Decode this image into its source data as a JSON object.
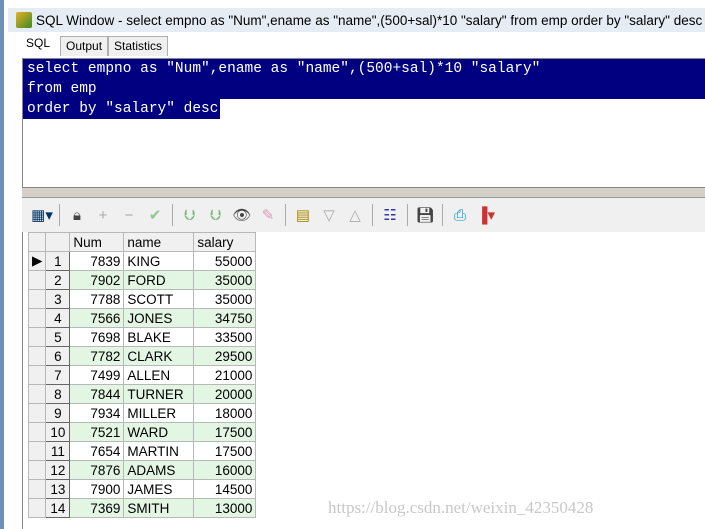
{
  "window": {
    "title": "SQL Window - select empno as \"Num\",ename as \"name\",(500+sal)*10 \"salary\" from emp order by \"salary\" desc"
  },
  "tabs": [
    {
      "label": "SQL",
      "active": true
    },
    {
      "label": "Output"
    },
    {
      "label": "Statistics"
    }
  ],
  "editor": {
    "lines": [
      "select empno as \"Num\",ename as \"name\",(500+sal)*10 \"salary\"",
      "from emp",
      "order by \"salary\" desc"
    ]
  },
  "toolbar": [
    "grid-view-icon",
    "lock-icon",
    "add-row-icon",
    "delete-row-icon",
    "post-icon",
    "fetch-next-icon",
    "fetch-all-icon",
    "find-icon",
    "clear-icon",
    "query-by-example-icon",
    "next-icon",
    "previous-icon",
    "explain-plan-icon",
    "save-icon",
    "print-icon",
    "chart-icon"
  ],
  "grid": {
    "columns": [
      "Num",
      "name",
      "salary"
    ],
    "rows": [
      {
        "n": "1",
        "num": "7839",
        "name": "KING",
        "salary": "55000"
      },
      {
        "n": "2",
        "num": "7902",
        "name": "FORD",
        "salary": "35000"
      },
      {
        "n": "3",
        "num": "7788",
        "name": "SCOTT",
        "salary": "35000"
      },
      {
        "n": "4",
        "num": "7566",
        "name": "JONES",
        "salary": "34750"
      },
      {
        "n": "5",
        "num": "7698",
        "name": "BLAKE",
        "salary": "33500"
      },
      {
        "n": "6",
        "num": "7782",
        "name": "CLARK",
        "salary": "29500"
      },
      {
        "n": "7",
        "num": "7499",
        "name": "ALLEN",
        "salary": "21000"
      },
      {
        "n": "8",
        "num": "7844",
        "name": "TURNER",
        "salary": "20000"
      },
      {
        "n": "9",
        "num": "7934",
        "name": "MILLER",
        "salary": "18000"
      },
      {
        "n": "10",
        "num": "7521",
        "name": "WARD",
        "salary": "17500"
      },
      {
        "n": "11",
        "num": "7654",
        "name": "MARTIN",
        "salary": "17500"
      },
      {
        "n": "12",
        "num": "7876",
        "name": "ADAMS",
        "salary": "16000"
      },
      {
        "n": "13",
        "num": "7900",
        "name": "JAMES",
        "salary": "14500"
      },
      {
        "n": "14",
        "num": "7369",
        "name": "SMITH",
        "salary": "13000"
      }
    ]
  },
  "watermark": "https://blog.csdn.net/weixin_42350428"
}
